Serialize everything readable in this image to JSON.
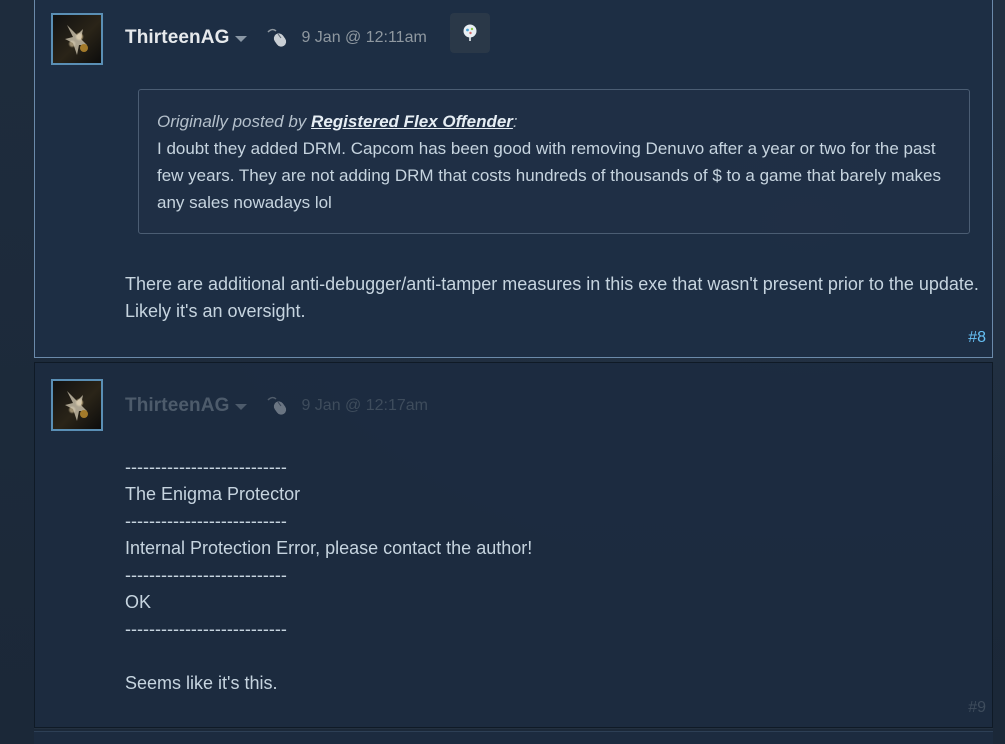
{
  "posts": [
    {
      "author": "ThirteenAG",
      "date": "9 Jan @ 12:11am",
      "quote": {
        "prefix": "Originally posted by",
        "author": "Registered Flex Offender",
        "suffix": ":",
        "text": "I doubt they added DRM. Capcom has been good with removing Denuvo after a year or two for the past few years. They are not adding DRM that costs hundreds of thousands of $ to a game that barely makes any sales nowadays lol"
      },
      "body": "There are additional anti-debugger/anti-tamper measures in this exe that wasn't present prior to the update. Likely it's an oversight.",
      "number": "#8"
    },
    {
      "author": "ThirteenAG",
      "date": "9 Jan @ 12:17am",
      "body_lines": [
        "---------------------------",
        "The Enigma Protector",
        "---------------------------",
        "Internal Protection Error, please contact the author!",
        "---------------------------",
        "OK",
        "---------------------------",
        "",
        "Seems like it's this."
      ],
      "number": "#9"
    }
  ],
  "icons": {
    "author_menu": "chevron-down-icon",
    "input_device": "mouse-icon",
    "award": "award-tree-icon"
  },
  "colors": {
    "background": "#1b2838",
    "highlight_border": "#6b8aaa",
    "post_number_active": "#66c0f4",
    "text": "#c6d4df"
  }
}
